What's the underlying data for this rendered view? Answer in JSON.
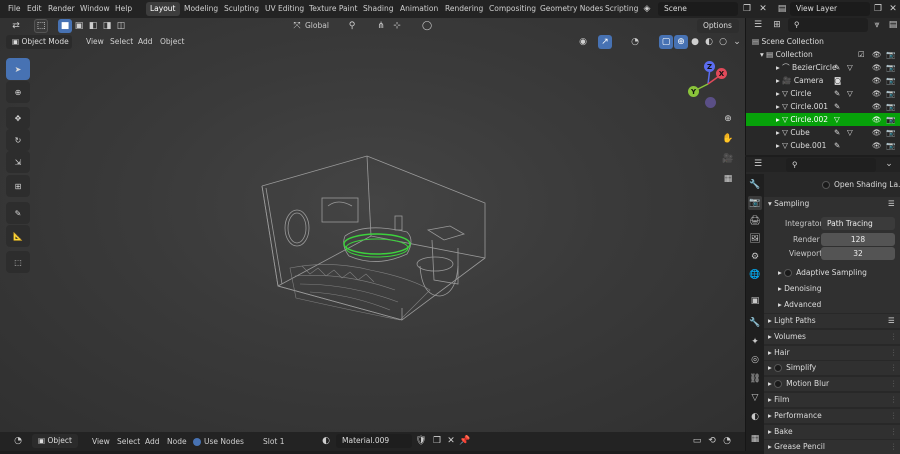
{
  "menus": [
    "File",
    "Edit",
    "Render",
    "Window",
    "Help"
  ],
  "workspaces": [
    "Layout",
    "Modeling",
    "Sculpting",
    "UV Editing",
    "Texture Paint",
    "Shading",
    "Animation",
    "Rendering",
    "Compositing",
    "Geometry Nodes",
    "Scripting"
  ],
  "active_workspace": "Layout",
  "scene": "Scene",
  "view_layer": "View Layer",
  "viewport_header": {
    "mode": "Object Mode",
    "menus": [
      "View",
      "Select",
      "Add",
      "Object"
    ],
    "transform_orientation": "Global",
    "options": "Options"
  },
  "gizmo": {
    "x": "X",
    "y": "Y",
    "z": "Z"
  },
  "outliner": {
    "root": "Scene Collection",
    "collection": "Collection",
    "items": [
      {
        "name": "BezierCircle",
        "active": false
      },
      {
        "name": "Camera",
        "active": false
      },
      {
        "name": "Circle",
        "active": false
      },
      {
        "name": "Circle.001",
        "active": false
      },
      {
        "name": "Circle.002",
        "active": true
      },
      {
        "name": "Cube",
        "active": false
      },
      {
        "name": "Cube.001",
        "active": false
      }
    ]
  },
  "properties": {
    "open_shading": "Open Shading La...",
    "sampling": "Sampling",
    "integrator_label": "Integrator",
    "integrator_value": "Path Tracing",
    "render_label": "Render",
    "render_value": "128",
    "viewport_label": "Viewport",
    "viewport_value": "32",
    "sub_panels": [
      "Adaptive Sampling",
      "Denoising",
      "Advanced"
    ],
    "panels": [
      "Light Paths",
      "Volumes",
      "Hair",
      "Simplify",
      "Motion Blur",
      "Film",
      "Performance",
      "Bake",
      "Grease Pencil"
    ]
  },
  "bottom_bar": {
    "object": "Object",
    "menus": [
      "View",
      "Select",
      "Add",
      "Node"
    ],
    "use_nodes": "Use Nodes",
    "slot": "Slot 1",
    "material": "Material.009"
  },
  "colors": {
    "accent": "#4772b3",
    "active_row": "#07a10a",
    "selection_outline": "#3dd13d"
  }
}
